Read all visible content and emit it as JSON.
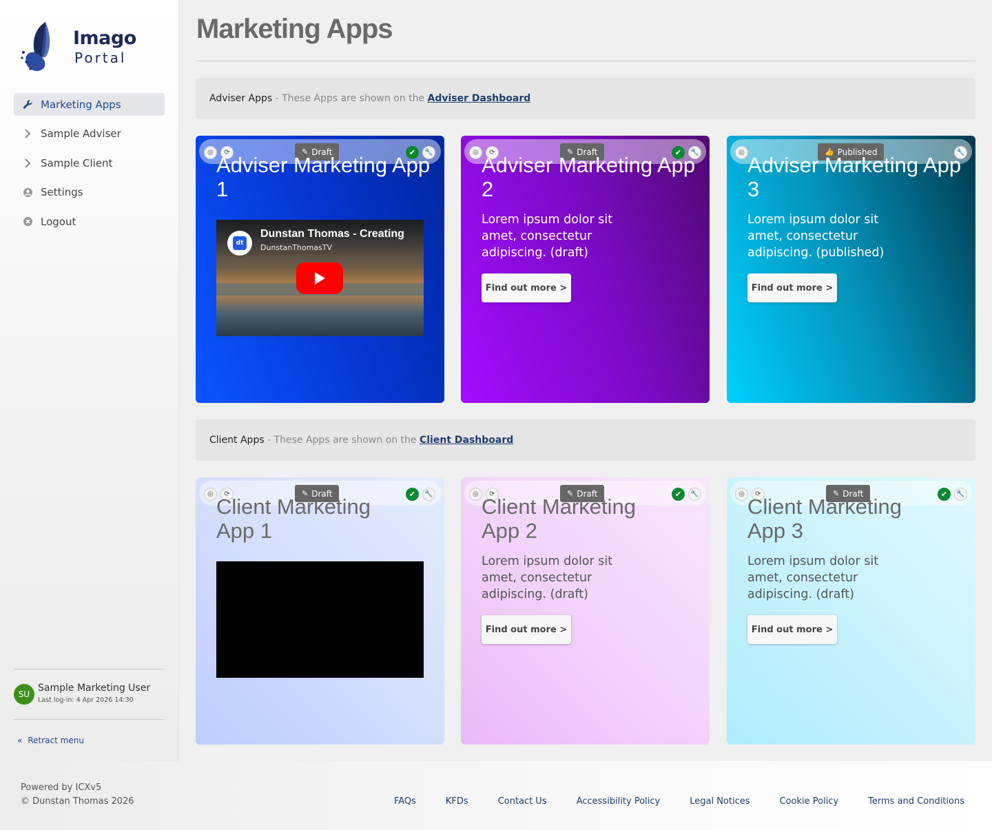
{
  "brand": {
    "name_line1": "Imago",
    "name_line2": "Portal"
  },
  "sidebar": {
    "items": [
      {
        "label": "Marketing Apps",
        "icon": "wrench-icon"
      },
      {
        "label": "Sample Adviser",
        "icon": "chevron-right-icon"
      },
      {
        "label": "Sample Client",
        "icon": "chevron-right-icon"
      },
      {
        "label": "Settings",
        "icon": "user-circle-icon"
      },
      {
        "label": "Logout",
        "icon": "close-circle-icon"
      }
    ],
    "user": {
      "initials": "SU",
      "name": "Sample Marketing User",
      "last_login": "Last log-in: 4 Apr 2026 14:30"
    },
    "retract_label": "Retract menu"
  },
  "page": {
    "title": "Marketing Apps"
  },
  "sections": {
    "adviser": {
      "name": "Adviser Apps",
      "desc": " - These Apps are shown on the ",
      "link": "Adviser Dashboard"
    },
    "client": {
      "name": "Client Apps",
      "desc": " - These Apps are shown on the ",
      "link": "Client Dashboard"
    }
  },
  "adviser_cards": [
    {
      "status": "Draft",
      "title": "Adviser Marketing App 1",
      "video_title": "Dunstan Thomas - Creating",
      "video_channel": "DunstanThomasTV",
      "video_logo": "dt",
      "gradient": [
        "#0a3fd9",
        "#0027b0"
      ]
    },
    {
      "status": "Draft",
      "title": "Adviser Marketing App 2",
      "text": "Lorem ipsum dolor sit amet, consectetur adipiscing. (draft)",
      "cta": "Find out more >",
      "gradient": [
        "#9d15f0",
        "#5c0a82"
      ]
    },
    {
      "status": "Published",
      "title": "Adviser Marketing App 3",
      "text": "Lorem ipsum dolor sit amet, consectetur adipiscing. (published)",
      "cta": "Find out more >",
      "gradient": [
        "#00c6ef",
        "#00394f"
      ]
    }
  ],
  "client_cards": [
    {
      "status": "Draft",
      "title": "Client Marketing App 1"
    },
    {
      "status": "Draft",
      "title": "Client Marketing App 2",
      "text": "Lorem ipsum dolor sit amet, consectetur adipiscing. (draft)",
      "cta": "Find out more >"
    },
    {
      "status": "Draft",
      "title": "Client Marketing App 3",
      "text": "Lorem ipsum dolor sit amet, consectetur adipiscing. (draft)",
      "cta": "Find out more >"
    }
  ],
  "footer": {
    "powered": "Powered by ICXv5",
    "copyright": "© Dunstan Thomas 2026",
    "links": [
      "FAQs",
      "KFDs",
      "Contact Us",
      "Accessibility Policy",
      "Legal Notices",
      "Cookie Policy",
      "Terms and Conditions"
    ]
  },
  "colors": {
    "accent": "#1e4a8c",
    "approved": "#0b8a2f",
    "avatar": "#3e8e1c"
  }
}
